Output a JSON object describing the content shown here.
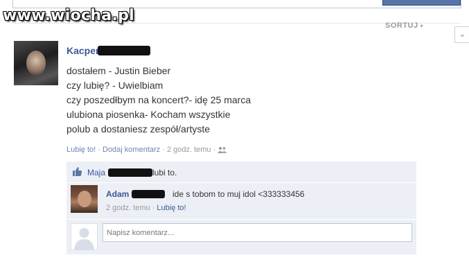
{
  "watermark": "www.wiocha.pl",
  "sort": {
    "label": "SORTUJ",
    "caret": "▾"
  },
  "post": {
    "author": "Kacper",
    "lines": [
      "dostałem - Justin Bieber",
      "czy lubię? - Uwielbiam",
      "czy poszedłbym na koncert?- idę 25 marca",
      "ulubiona piosenka- Kocham wszystkie",
      "polub a dostaniesz zespół/artyste"
    ],
    "like_label": "Lubię to!",
    "comment_label": "Dodaj komentarz",
    "time": "2 godz. temu",
    "sep": "·"
  },
  "likes": {
    "user": "Maja",
    "suffix": "lubi to."
  },
  "comment": {
    "author": "Adam",
    "text": "ide s tobom to muj idol <333333456",
    "time": "2 godz. temu",
    "like_label": "Lubię to!"
  },
  "comment_box": {
    "placeholder": "Napisz komentarz..."
  },
  "colors": {
    "link": "#3b5998",
    "meta_link": "#6d84b4",
    "block_bg": "#eceff5"
  }
}
